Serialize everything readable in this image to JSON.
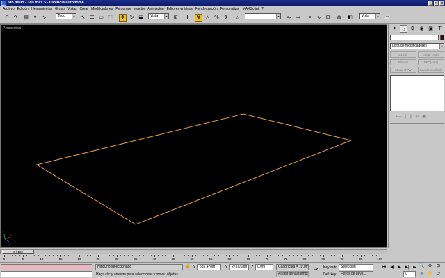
{
  "window": {
    "title": "Sin título - 3ds max 6 - Licencia autónoma",
    "minimize_glyph": "_",
    "maximize_glyph": "□",
    "close_glyph": "x"
  },
  "menu": [
    "Archivo",
    "Edición",
    "Herramientas",
    "Grupo",
    "Vistas",
    "Crear",
    "Modificadores",
    "Personaje",
    "reactor",
    "Animación",
    "Editores gráficos",
    "Renderización",
    "Personalizar",
    "MAXScript",
    "?"
  ],
  "toolbar": {
    "selection_filter": "Todo",
    "reference_coord": "Vista",
    "named_selection": "",
    "render_view": "Vista",
    "dropdown_glyph": "▾",
    "icons": [
      "undo-icon",
      "redo-icon",
      "select-link-icon",
      "unlink-icon",
      "bind-spacewarp-icon",
      "select-object-icon",
      "select-by-name-icon",
      "region-select-icon",
      "crossing-icon",
      "select-move-icon",
      "select-rotate-icon",
      "select-scale-icon",
      "pivot-icon",
      "mirror-icon",
      "align-icon",
      "layer-icon",
      "curve-editor-icon",
      "schematic-icon",
      "material-editor-icon",
      "render-scene-icon",
      "quick-render-icon"
    ]
  },
  "viewport": {
    "label": "Perspectiva",
    "plane_color": "#e8a050",
    "background": "#000000",
    "axis_x_label": "X",
    "axis_y_label": "Y",
    "axis_z_label": "Z"
  },
  "command_panel": {
    "tabs": [
      "create-tab-icon",
      "modify-tab-icon",
      "hierarchy-tab-icon",
      "motion-tab-icon",
      "display-tab-icon",
      "utilities-tab-icon"
    ],
    "tab_glyphs": [
      "✦",
      "⌂",
      "⚙",
      "◉",
      "▣",
      "T"
    ],
    "object_name": "",
    "object_color": "#3a0a0a",
    "modifier_list": "Lista de modificadores",
    "dropdown_glyph": "▾",
    "buttons": [
      "Extruir",
      "Editar malla",
      "Biselar",
      "FFD(caja)",
      "Mapa UVW",
      "Suavizamallado"
    ],
    "stack_icons": [
      "⟵",
      "|",
      "∥",
      "⊕",
      "▣"
    ]
  },
  "timeline": {
    "current": "0 / 100",
    "ticks": [
      "0",
      "5",
      "10",
      "15",
      "20",
      "25",
      "30",
      "35",
      "40",
      "45",
      "50",
      "55",
      "60",
      "65",
      "70",
      "75",
      "80",
      "85",
      "90",
      "95",
      "100"
    ],
    "max_frame": 100
  },
  "status": {
    "selection": "Ninguno seleccionado",
    "prompt": "Haga clic y arrastre para seleccionar y mover objetos",
    "x_label": "X",
    "x_value": "585,478m",
    "y_label": "Y",
    "y_value": "273,018m",
    "z_label": "Z",
    "z_value": "0,0m",
    "grid": "Cuadrícula = 10,0m",
    "add_time_tag": "Añadir señal tiempo",
    "key_auto": "Key auto",
    "key_set": "Def. key",
    "key_selection": "Selección",
    "key_filters": "Filtros de keys...",
    "frame": "0",
    "lock_glyph": "🔒",
    "key_glyph": "⊸",
    "playback_glyphs": [
      "⏮",
      "◀",
      "▶",
      "▶|",
      "⏭"
    ]
  }
}
